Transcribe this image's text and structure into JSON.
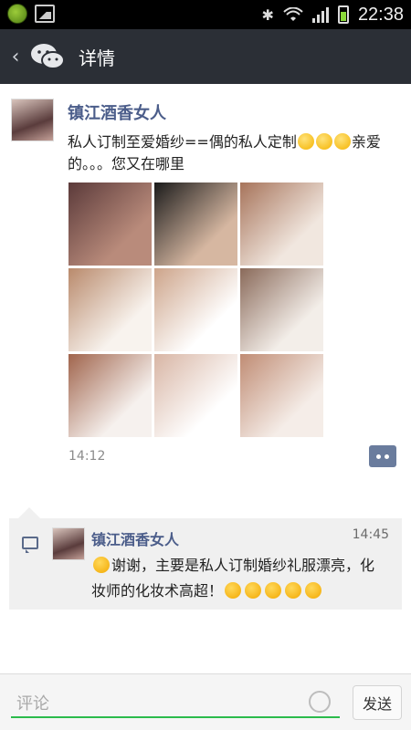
{
  "status_bar": {
    "time": "22:38",
    "icons": [
      "app-icon",
      "photo-icon",
      "bluetooth-icon",
      "wifi-icon",
      "signal-icon",
      "battery-icon"
    ]
  },
  "header": {
    "back_icon": "chevron-left-icon",
    "logo_icon": "wechat-logo-icon",
    "title": "详情"
  },
  "post": {
    "author": "镇江酒香女人",
    "text_main": "私人订制至爱婚纱==偶的私人定制",
    "text_after": "亲爱的。。。您又在哪里",
    "photos": [
      {
        "name": "photo-1",
        "colors": [
          "#5b3a3a",
          "#b98b7b"
        ]
      },
      {
        "name": "photo-2",
        "colors": [
          "#1b1b1b",
          "#d6b7a1"
        ]
      },
      {
        "name": "photo-3",
        "colors": [
          "#a7745b",
          "#f1e7df"
        ]
      },
      {
        "name": "photo-4",
        "colors": [
          "#b98a6c",
          "#f8f3ee"
        ]
      },
      {
        "name": "photo-5",
        "colors": [
          "#cda48a",
          "#ffffff"
        ]
      },
      {
        "name": "photo-6",
        "colors": [
          "#8a6a5a",
          "#f3eee9"
        ]
      },
      {
        "name": "photo-7",
        "colors": [
          "#a0644c",
          "#f6f1ee"
        ]
      },
      {
        "name": "photo-8",
        "colors": [
          "#d8b5a4",
          "#ffffff"
        ]
      },
      {
        "name": "photo-9",
        "colors": [
          "#c08c74",
          "#f5ede8"
        ]
      }
    ],
    "time": "14:12"
  },
  "comment": {
    "author": "镇江酒香女人",
    "time": "14:45",
    "line1": "谢谢，主要是私人订制婚纱礼服漂亮，化",
    "line2": "妆师的化妆术高超！"
  },
  "composer": {
    "placeholder": "评论",
    "send_label": "发送",
    "emoji_icon": "smiley-icon"
  },
  "colors": {
    "accent_green": "#2bbb4b",
    "name_blue": "#4b5d8a",
    "titlebar_bg": "#2b2f36"
  }
}
